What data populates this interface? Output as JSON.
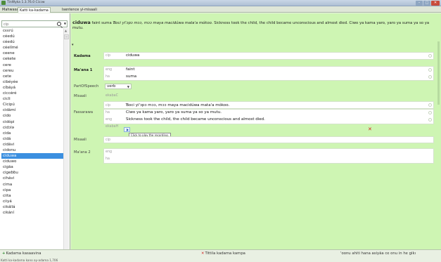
{
  "window": {
    "title": "TinWyka 1.3.76.0 Ciɔɔw",
    "controls": {
      "minimize": "–",
      "maximize": "□",
      "close": "✕"
    }
  },
  "tabs": [
    {
      "label": "Mahwasari"
    },
    {
      "label": "Katti ka-kadama"
    },
    {
      "label": "Isentence yi-misaali"
    }
  ],
  "sidebar": {
    "search_placeholder": "cip",
    "words": [
      "cɛɛrú",
      "céedú",
      "céedú",
      "céelímé",
      "ceene",
      "cekete",
      "cere",
      "cereu",
      "cete",
      "cibéyée",
      "cíbáyá",
      "ciccéré",
      "cicli",
      "Cicipú",
      "cidámí",
      "cido",
      "cidópi",
      "cidɔlə",
      "cida",
      "cidá",
      "cidávi",
      "cidonu",
      "ciduwa",
      "ciduwo",
      "cigãa",
      "cigeɓɓu",
      "cihávi",
      "cima",
      "cipa",
      "ciita",
      "ciiyá",
      "cikállá",
      "cikání"
    ],
    "selected_index": 22
  },
  "entry": {
    "headword": "ciduwa",
    "header_rest_1": "faint",
    "header_rest_2": "suma",
    "header_example": "Ɓoci yi'ɔpɔ mɔɔ, mɔɔ maya macidúwa mata'a mókoo.",
    "header_translation_en": "Sickness took the child, the child became unconscious and almost died.",
    "header_translation_ha": "Ciwo ya kama yaro, yaro ya suma ya so ya mutu.",
    "labels": {
      "kadama": "Kadama",
      "meaning1": "Ma'ana 1",
      "part_of_speech": "PartOfSpeech",
      "misaali": "Misaali",
      "fassarawa": "Fassarawa",
      "misaali2": "Misaali",
      "meaning2": "Ma'ana 2"
    },
    "ws": {
      "cip": "cip",
      "eng": "eng",
      "ha": "ha",
      "ekabaC": "ekabaC",
      "ekabaH": "ekabaH"
    },
    "kadama_value": "ciduwa",
    "meaning1_eng": "faint",
    "meaning1_ha": "suma",
    "part_of_speech_value": "verb",
    "example_cip": "Ɓoci yi'ɔpɔ mɔɔ, mɔɔ maya macidúwa mata'a mókoo.",
    "translation_ha": "Ciwo ya kama yaro, yaro ya suma ya so ya mutu.",
    "translation_eng": "Sickness took the child, the child became unconscious and almost died.",
    "play_tooltip": "Click to play the recording."
  },
  "bottombar": {
    "add_entry": "Kadama kasaavina",
    "delete_entry": "Tittila kadama kampa",
    "show_all": "'oonu ahiti hana asiyãa ce onu in he gikı",
    "status": "Katti ka-kadama kano ay-adama 1,706"
  }
}
